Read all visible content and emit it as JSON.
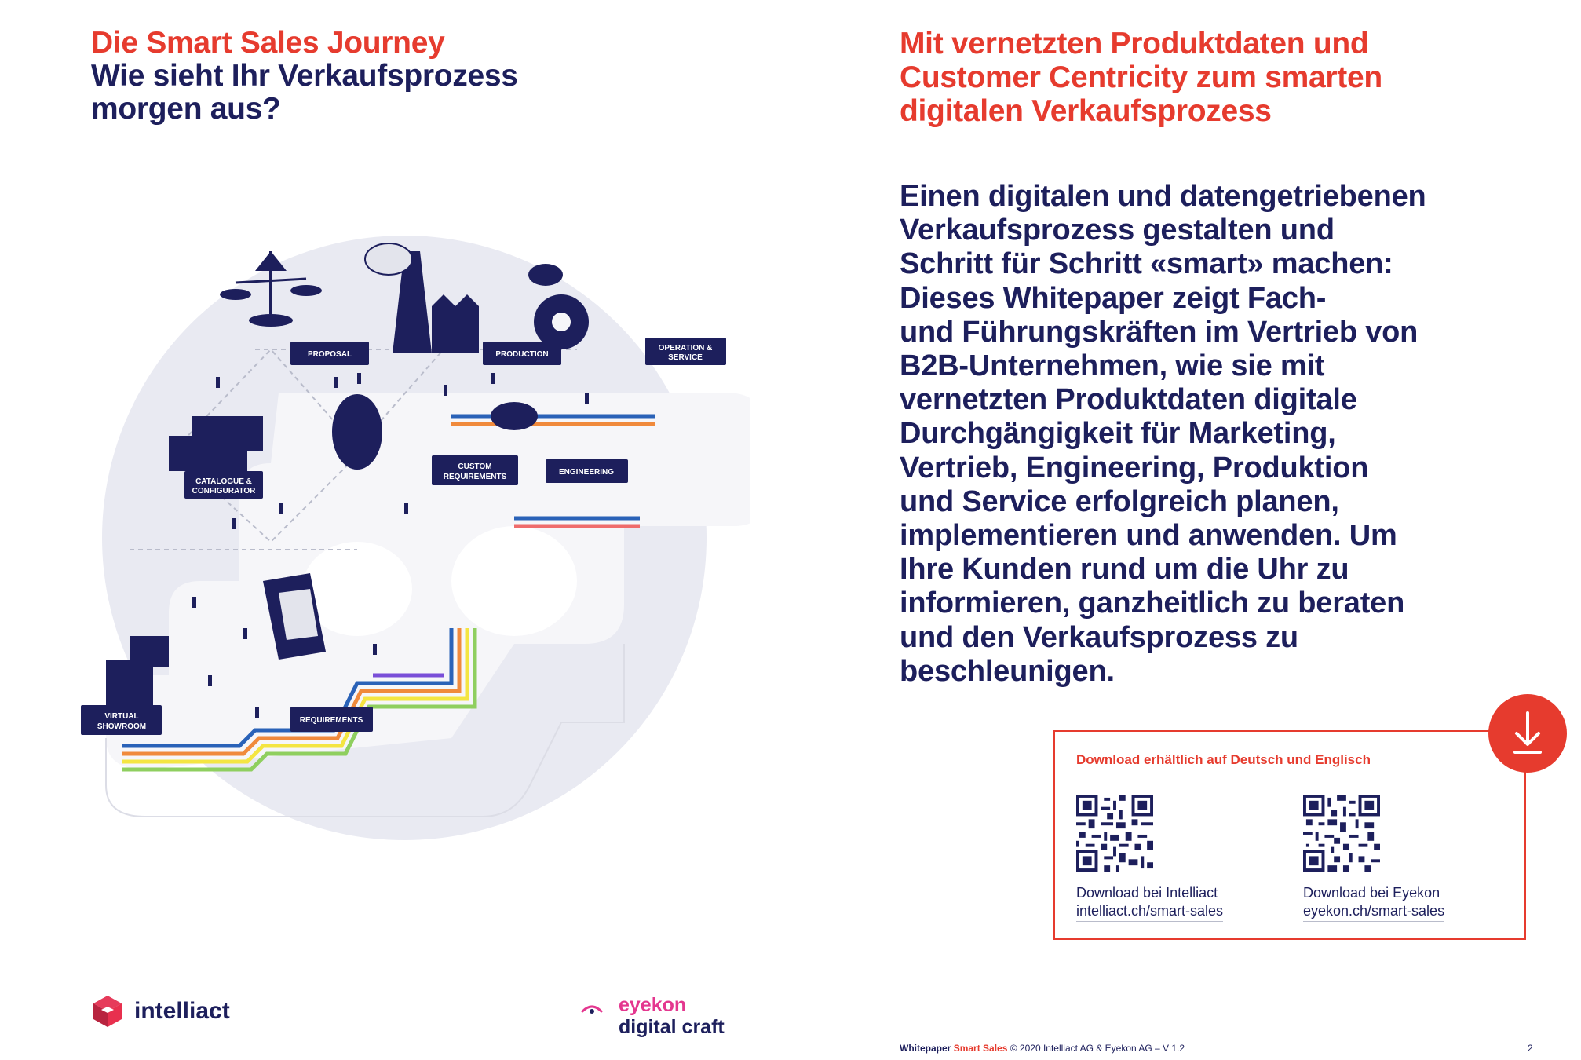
{
  "left": {
    "title_red": "Die Smart Sales Journey",
    "title_navy_line1": "Wie sieht Ihr Verkaufsprozess",
    "title_navy_line2": "morgen aus?"
  },
  "illustration": {
    "labels": {
      "proposal": "PROPOSAL",
      "production": "PRODUCTION",
      "operation_1": "OPERATION &",
      "operation_2": "SERVICE",
      "catalogue_1": "CATALOGUE &",
      "catalogue_2": "CONFIGURATOR",
      "custom_1": "CUSTOM",
      "custom_2": "REQUIREMENTS",
      "engineering": "ENGINEERING",
      "virtual_1": "VIRTUAL",
      "virtual_2": "SHOWROOM",
      "requirements": "REQUIREMENTS"
    },
    "colors": {
      "navy": "#1d1f5c",
      "blob": "#e9eaf2",
      "platform": "#f4f4f8",
      "stripes": [
        "#2a62b8",
        "#f08a3c",
        "#f4e542",
        "#8fcf5f",
        "#7a4fd8",
        "#ef6c6c"
      ]
    }
  },
  "right": {
    "headline_lines": [
      "Mit vernetzten Produktdaten und",
      "Customer Centricity zum smarten",
      "digitalen Verkaufsprozess"
    ],
    "body_lines": [
      "Einen digitalen und datengetriebenen",
      "Verkaufsprozess gestalten und",
      "Schritt für Schritt «smart» machen:",
      "Dieses Whitepaper zeigt Fach-",
      "und Führungskräften im Vertrieb von",
      "B2B-Unternehmen, wie sie mit",
      "vernetzten Produktdaten digitale",
      "Durchgängigkeit für Marketing,",
      "Vertrieb, Engineering, Produktion",
      "und Service erfolgreich planen,",
      "implementieren und anwenden. Um",
      "Ihre Kunden rund um die Uhr zu",
      "informieren, ganzheitlich zu beraten",
      "und den Verkaufsprozess zu",
      "beschleunigen."
    ]
  },
  "download": {
    "title": "Download erhältlich auf Deutsch und Englisch",
    "icon": "download-arrow-icon",
    "accent": "#e63b2e",
    "items": [
      {
        "caption": "Download bei Intelliact",
        "link": "intelliact.ch/smart-sales"
      },
      {
        "caption": "Download bei Eyekon",
        "link": "eyekon.ch/smart-sales"
      }
    ]
  },
  "logos": {
    "intelliact": "intelliact",
    "eyekon_line1": "eyekon",
    "eyekon_line2": "digital craft",
    "eyekon_pink": "#e4378f"
  },
  "footer": {
    "doc": "Whitepaper",
    "doc_highlight": "Smart Sales",
    "copyright": "© 2020 Intelliact AG & Eyekon AG – V 1.2",
    "page": "2"
  }
}
